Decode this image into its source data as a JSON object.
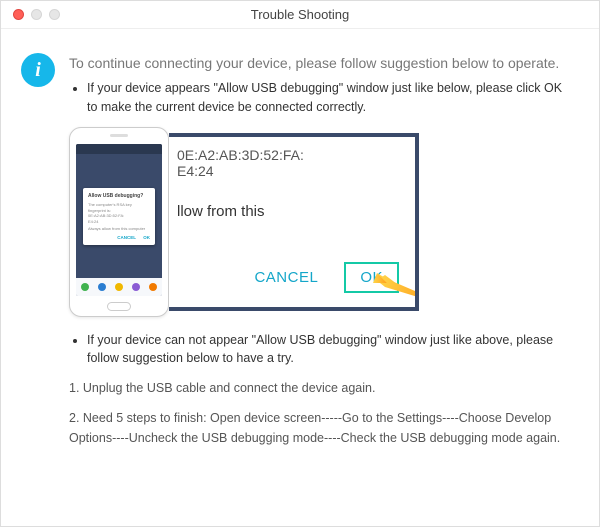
{
  "window": {
    "title": "Trouble Shooting"
  },
  "lead": "To continue connecting your device, please follow suggestion below to operate.",
  "bullets": {
    "b1": "If your device appears \"Allow USB debugging\" window just like below, please click OK to make the current device  be connected correctly.",
    "b2": "If your device can not appear \"Allow USB debugging\" window just like above, please follow suggestion below to have a try."
  },
  "phone_popup": {
    "title": "Allow USB debugging?",
    "line1": "The computer's RSA key",
    "line2": "fingerprint is:",
    "line3": "0E:A2:AB:3D:52:FA:",
    "line4": "E4:24",
    "check": "Always allow from this computer",
    "cancel": "CANCEL",
    "ok": "OK"
  },
  "zoom": {
    "mac1": "0E:A2:AB:3D:52:FA:",
    "mac2": "E4:24",
    "allow_partial": "llow from this",
    "cancel": "CANCEL",
    "ok": "OK"
  },
  "steps": {
    "s1": "1. Unplug the USB cable and connect the device again.",
    "s2": "2. Need 5 steps to finish: Open device screen-----Go to the Settings----Choose Develop Options----Uncheck the USB debugging mode----Check the USB debugging mode again."
  },
  "nav_colors": [
    "#3fb24f",
    "#2a7dd1",
    "#f0b800",
    "#8a5bd4",
    "#f17a00"
  ]
}
